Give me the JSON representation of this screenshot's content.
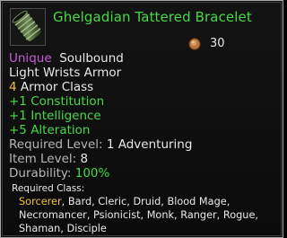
{
  "item": {
    "icon": "bracelet-icon",
    "name": "Ghelgadian Tattered Bracelet",
    "price": {
      "icon": "copper-coin-icon",
      "value": "30"
    },
    "rarity": "Unique",
    "binding": "Soulbound",
    "armor_type": "Light Wrists Armor",
    "armor_class_value": "4",
    "armor_class_label": "Armor Class",
    "stats": [
      "+1 Constitution",
      "+1 Intelligence",
      "+5 Alteration"
    ],
    "required_level_label": "Required Level:",
    "required_level_value": "1 Adventuring",
    "item_level_label": "Item Level:",
    "item_level_value": "8",
    "durability_label": "Durability:",
    "durability_value": "100%",
    "required_class_label": "Required Class:",
    "required_classes_highlight": "Sorcerer",
    "required_classes_rest": ", Bard, Cleric, Druid, Blood Mage, Necromancer, Psionicist, Monk, Ranger, Rogue, Shaman, Disciple"
  },
  "colors": {
    "name": "#46d946",
    "rarity": "#c85ad8",
    "stat": "#46d946",
    "armor_class_value": "#f1c232",
    "label": "#b7b7b7",
    "highlight_class": "#f1c232"
  }
}
